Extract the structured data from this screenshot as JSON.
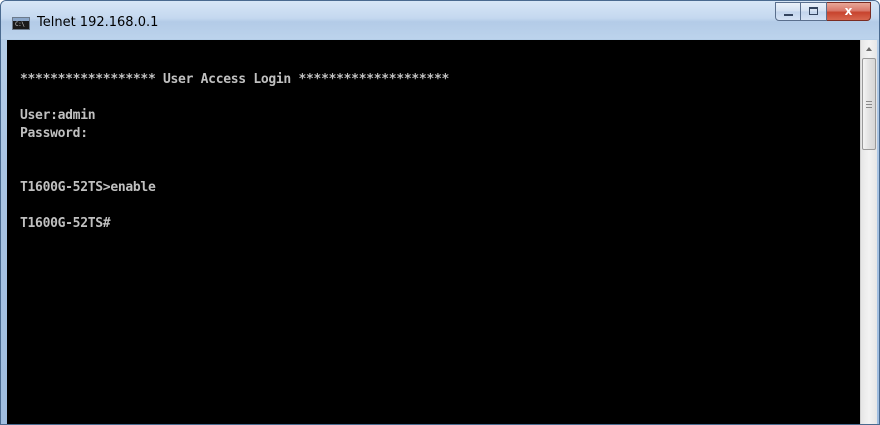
{
  "window": {
    "title": "Telnet 192.168.0.1",
    "icon": "console-icon",
    "icon_text": "C:\\"
  },
  "caption_buttons": {
    "minimize": "minimize-icon",
    "maximize": "maximize-icon",
    "close": "close-icon",
    "close_glyph": "x"
  },
  "console": {
    "background": "#000000",
    "foreground": "#c0c0c0",
    "lines": [
      "****************** User Access Login ********************",
      "",
      "User:admin",
      "Password:",
      "",
      "",
      "T1600G-52TS>enable",
      "",
      "T1600G-52TS#"
    ]
  },
  "scrollbar": {
    "up_arrow": "scroll-up-arrow-icon",
    "thumb": "scroll-thumb"
  }
}
